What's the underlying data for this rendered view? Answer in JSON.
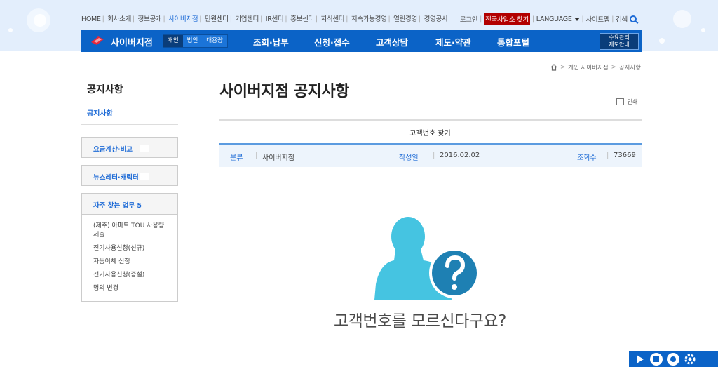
{
  "top_nav": {
    "links": [
      "HOME",
      "회사소개",
      "정보공개",
      "사이버지점",
      "민원센터",
      "기업센터",
      "IR센터",
      "홍보센터",
      "지식센터",
      "지속가능경영",
      "열린경영",
      "경영공시"
    ],
    "active_index": 3
  },
  "utility": {
    "login": "로그인",
    "find_branch": "전국사업소 찾기",
    "language": "LANGUAGE",
    "sitemap": "사이트맵",
    "search": "검색"
  },
  "gnb": {
    "brand": "사이버지점",
    "segments": [
      "개인",
      "법인",
      "대용량"
    ],
    "menu": [
      "조회·납부",
      "신청·접수",
      "고객상담",
      "제도·약관",
      "통합포털"
    ],
    "demand_line1": "수요관리",
    "demand_line2": "제도안내"
  },
  "breadcrumb": [
    "개인 사이버지점",
    "공지사항"
  ],
  "lnb": {
    "title": "공지사항",
    "sub_item": "공지사항",
    "box1": "요금계산·비교",
    "box2": "뉴스레터·캐릭터",
    "fav_title": "자주 찾는 업무 5",
    "fav_items": [
      "(제주) 아파트 TOU 사용량 제출",
      "전기사용신청(신규)",
      "자동이체 신청",
      "전기사용신청(증설)",
      "명의 변경"
    ]
  },
  "content": {
    "page_title": "사이버지점 공지사항",
    "print_label": "인쇄",
    "post_title": "고객번호 찾기",
    "meta": {
      "category_label": "분류",
      "category_value": "사이버지점",
      "date_label": "작성일",
      "date_value": "2016.02.02",
      "views_label": "조회수",
      "views_value": "73669"
    },
    "body_text": "고객번호를 모르신다구요?"
  },
  "colors": {
    "primary": "#0b63c7",
    "header_bg": "#e3eefc",
    "figure_person": "#45c4e1",
    "figure_badge": "#1e80b3"
  }
}
